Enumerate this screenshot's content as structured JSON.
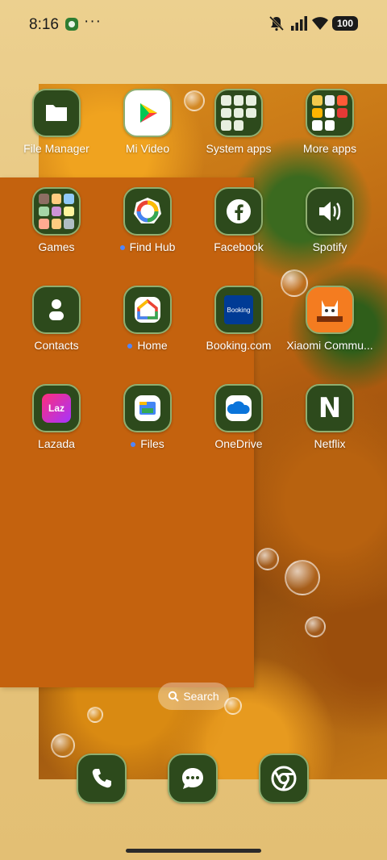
{
  "status_bar": {
    "time": "8:16",
    "overflow": "···",
    "battery": "100"
  },
  "home_row": [
    {
      "label": "File Manager"
    },
    {
      "label": "Mi Video"
    },
    {
      "label": "System apps"
    },
    {
      "label": "More apps"
    }
  ],
  "apps": [
    {
      "label": "Games"
    },
    {
      "label": "Find Hub"
    },
    {
      "label": "Facebook"
    },
    {
      "label": "Spotify"
    },
    {
      "label": "Contacts"
    },
    {
      "label": "Home"
    },
    {
      "label": "Booking.com",
      "icon_text": "Booking"
    },
    {
      "label": "Xiaomi Commu..."
    },
    {
      "label": "Lazada",
      "icon_text": "Laz"
    },
    {
      "label": "Files"
    },
    {
      "label": "OneDrive"
    },
    {
      "label": "Netflix",
      "icon_text": "N"
    }
  ],
  "search": {
    "label": "Search"
  },
  "dock": [
    "phone",
    "messages",
    "chrome"
  ]
}
